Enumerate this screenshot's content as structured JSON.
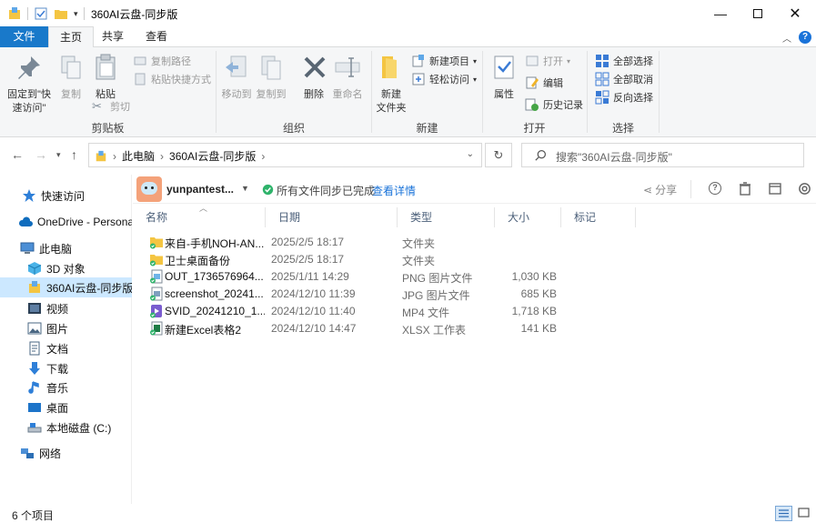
{
  "window": {
    "title": "360AI云盘-同步版",
    "controls": [
      "minimize",
      "maximize",
      "close"
    ]
  },
  "ribbon_tabs": {
    "file": "文件",
    "home": "主页",
    "share": "共享",
    "view": "查看"
  },
  "ribbon": {
    "clipboard": {
      "label": "剪贴板",
      "pin": "固定到\"快",
      "pin2": "速访问\"",
      "copy": "复制",
      "paste": "粘贴",
      "copy_path": "复制路径",
      "paste_shortcut": "粘贴快捷方式",
      "cut": "剪切"
    },
    "organize": {
      "label": "组织",
      "move_to": "移动到",
      "copy_to": "复制到",
      "delete": "删除",
      "rename": "重命名"
    },
    "new": {
      "label": "新建",
      "new_folder": "新建",
      "new_folder2": "文件夹",
      "new_item": "新建项目",
      "easy_access": "轻松访问"
    },
    "open": {
      "label": "打开",
      "properties": "属性",
      "open": "打开",
      "edit": "编辑",
      "history": "历史记录"
    },
    "select": {
      "label": "选择",
      "select_all": "全部选择",
      "select_none": "全部取消",
      "invert": "反向选择"
    }
  },
  "address": {
    "crumbs": [
      "此电脑",
      "360AI云盘-同步版"
    ],
    "search_placeholder": "搜索\"360AI云盘-同步版\""
  },
  "nav_pane": {
    "items": [
      {
        "label": "快速访问",
        "icon": "star-icon"
      },
      {
        "label": "OneDrive - Persona",
        "icon": "cloud-icon"
      },
      {
        "label": "此电脑",
        "icon": "computer-icon"
      },
      {
        "label": "3D 对象",
        "icon": "cube-icon"
      },
      {
        "label": "360AI云盘-同步版",
        "icon": "sync-drive-icon"
      },
      {
        "label": "视频",
        "icon": "video-icon"
      },
      {
        "label": "图片",
        "icon": "picture-icon"
      },
      {
        "label": "文档",
        "icon": "document-icon"
      },
      {
        "label": "下载",
        "icon": "download-icon"
      },
      {
        "label": "音乐",
        "icon": "music-icon"
      },
      {
        "label": "桌面",
        "icon": "desktop-icon"
      },
      {
        "label": "本地磁盘 (C:)",
        "icon": "drive-icon"
      },
      {
        "label": "网络",
        "icon": "network-icon"
      }
    ]
  },
  "cloud_bar": {
    "user": "yunpantest...",
    "sync_status": "所有文件同步已完成",
    "details_link": "查看详情",
    "share": "分享"
  },
  "columns": {
    "name": "名称",
    "date": "日期",
    "type": "类型",
    "size": "大小",
    "tags": "标记"
  },
  "files": [
    {
      "name": "来自-手机NOH-AN...",
      "date": "2025/2/5 18:17",
      "type": "文件夹",
      "size": "",
      "icon": "folder-icon"
    },
    {
      "name": "卫士桌面备份",
      "date": "2025/2/5 18:17",
      "type": "文件夹",
      "size": "",
      "icon": "folder-icon"
    },
    {
      "name": "OUT_1736576964...",
      "date": "2025/1/11 14:29",
      "type": "PNG 图片文件",
      "size": "1,030 KB",
      "icon": "png-file-icon"
    },
    {
      "name": "screenshot_20241...",
      "date": "2024/12/10 11:39",
      "type": "JPG 图片文件",
      "size": "685 KB",
      "icon": "jpg-file-icon"
    },
    {
      "name": "SVID_20241210_1...",
      "date": "2024/12/10 11:40",
      "type": "MP4 文件",
      "size": "1,718 KB",
      "icon": "mp4-file-icon"
    },
    {
      "name": "新建Excel表格2",
      "date": "2024/12/10 14:47",
      "type": "XLSX 工作表",
      "size": "141 KB",
      "icon": "xlsx-file-icon"
    }
  ],
  "status": {
    "item_count": "6 个项目"
  },
  "colors": {
    "file_tab": "#1979ca",
    "selection": "#cce8ff",
    "link": "#1a73d9",
    "sync_ok": "#2fb36b"
  }
}
